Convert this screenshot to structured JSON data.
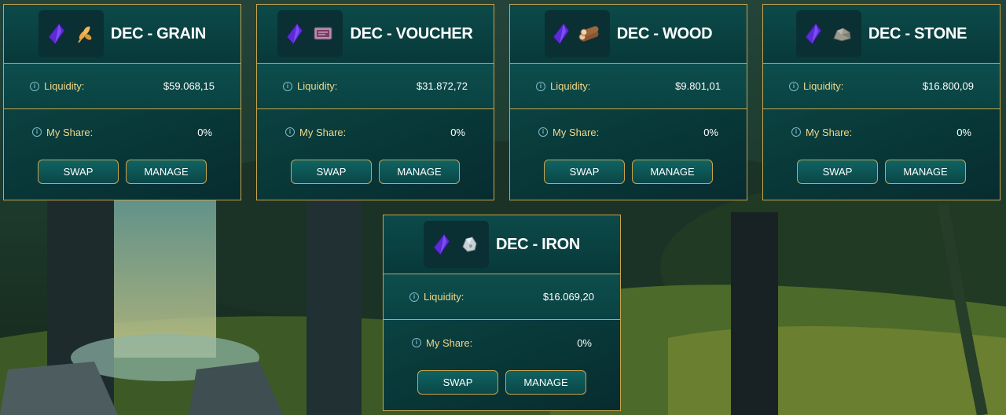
{
  "pools": [
    {
      "title": "DEC - GRAIN",
      "resource_icon": "grain-icon",
      "liquidity_label": "Liquidity:",
      "liquidity_value": "$59.068,15",
      "share_label": "My Share:",
      "share_value": "0%",
      "swap_label": "SWAP",
      "manage_label": "MANAGE"
    },
    {
      "title": "DEC - VOUCHER",
      "resource_icon": "voucher-icon",
      "liquidity_label": "Liquidity:",
      "liquidity_value": "$31.872,72",
      "share_label": "My Share:",
      "share_value": "0%",
      "swap_label": "SWAP",
      "manage_label": "MANAGE"
    },
    {
      "title": "DEC - WOOD",
      "resource_icon": "wood-icon",
      "liquidity_label": "Liquidity:",
      "liquidity_value": "$9.801,01",
      "share_label": "My Share:",
      "share_value": "0%",
      "swap_label": "SWAP",
      "manage_label": "MANAGE"
    },
    {
      "title": "DEC - STONE",
      "resource_icon": "stone-icon",
      "liquidity_label": "Liquidity:",
      "liquidity_value": "$16.800,09",
      "share_label": "My Share:",
      "share_value": "0%",
      "swap_label": "SWAP",
      "manage_label": "MANAGE"
    },
    {
      "title": "DEC - IRON",
      "resource_icon": "iron-icon",
      "liquidity_label": "Liquidity:",
      "liquidity_value": "$16.069,20",
      "share_label": "My Share:",
      "share_value": "0%",
      "swap_label": "SWAP",
      "manage_label": "MANAGE"
    }
  ],
  "colors": {
    "card_border": "#c8a44f",
    "card_bg": "#0a4040",
    "label_text": "#f0d78a",
    "value_text": "#ffffff",
    "dec_crystal": "#5b2bd6"
  },
  "icons": {
    "token_icon": "dec-crystal-icon",
    "info_icon": "info-circle-icon"
  }
}
